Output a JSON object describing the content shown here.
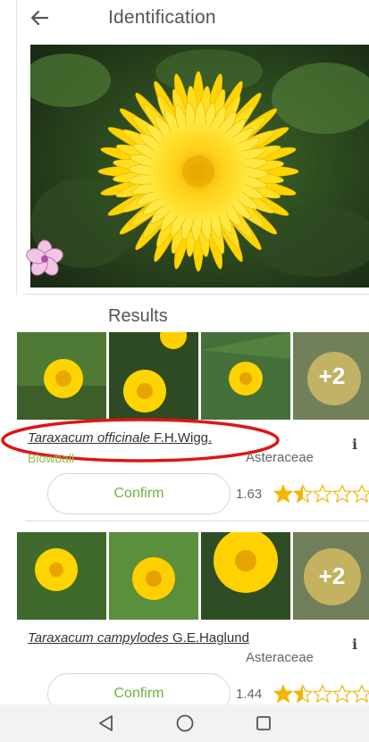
{
  "header": {
    "title": "Identification",
    "back_icon": "arrow-left-icon"
  },
  "results_title": "Results",
  "results": [
    {
      "scientific_name": "Taraxacum officinale",
      "author": " F.H.Wigg.",
      "common_name": "Blowball",
      "family": "Asteraceae",
      "confirm_label": "Confirm",
      "score": "1.63",
      "rating": 1.5,
      "more_images": "+2"
    },
    {
      "scientific_name": "Taraxacum campylodes",
      "author": " G.E.Haglund",
      "common_name": "",
      "family": "Asteraceae",
      "confirm_label": "Confirm",
      "score": "1.44",
      "rating": 1.5,
      "more_images": "+2"
    }
  ],
  "colors": {
    "accent_green": "#8ac24a",
    "confirm_text": "#6cb33f",
    "star_fill": "#f2b705",
    "highlight_ring": "#e01515"
  },
  "navbar": {
    "back": "triangle-back-icon",
    "home": "circle-home-icon",
    "recents": "square-recents-icon"
  }
}
